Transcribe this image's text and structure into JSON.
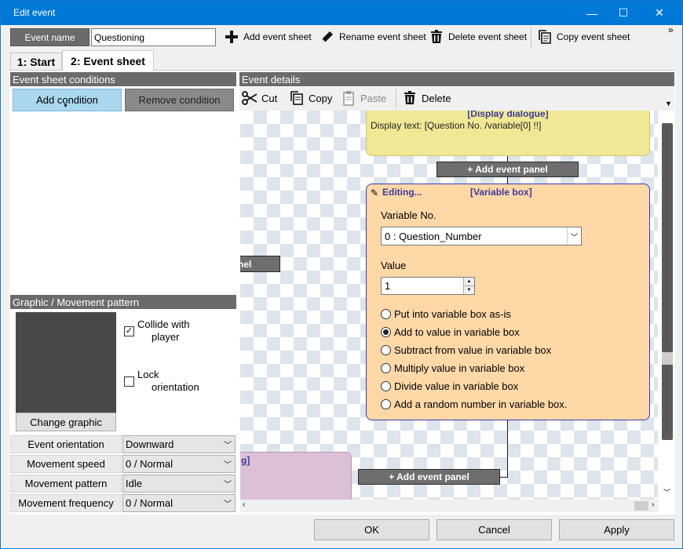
{
  "window": {
    "title": "Edit event",
    "min_glyph": "—",
    "max_glyph": "☐",
    "close_glyph": "✕"
  },
  "header": {
    "event_name_label": "Event name",
    "event_name_value": "Questioning",
    "toolbar": {
      "add_sheet": "Add event sheet",
      "rename_sheet": "Rename event sheet",
      "delete_sheet": "Delete event sheet",
      "copy_sheet": "Copy event sheet",
      "overflow": "»"
    }
  },
  "tabs": [
    {
      "label": "1: Start"
    },
    {
      "label": "2: Event sheet"
    }
  ],
  "conditions": {
    "header": "Event sheet conditions",
    "add_button": "Add condition",
    "remove_button": "Remove condition"
  },
  "graphic": {
    "header": "Graphic / Movement pattern",
    "collide_label_1": "Collide  with",
    "collide_label_2": "player",
    "collide_checked": true,
    "lock_label_1": "Lock",
    "lock_label_2": "orientation",
    "lock_checked": false,
    "change_button": "Change graphic"
  },
  "properties": [
    {
      "label": "Event orientation",
      "value": "Downward"
    },
    {
      "label": "Movement speed",
      "value": "0 / Normal"
    },
    {
      "label": "Movement pattern",
      "value": "Idle"
    },
    {
      "label": "Movement frequency",
      "value": "0 / Normal"
    }
  ],
  "details": {
    "header": "Event details",
    "cut": "Cut",
    "copy": "Copy",
    "paste": "Paste",
    "delete": "Delete"
  },
  "canvas": {
    "dialogue_panel": {
      "title": "[Display dialogue]",
      "text": "Display text: [Question No. /variable[0] !!]"
    },
    "add_panel_top": "+ Add event panel",
    "add_panel_bottom": "+ Add event panel",
    "left_fragment": "nel",
    "pink_fragment": "g]",
    "variable_panel": {
      "editing": "Editing...",
      "title": "[Variable box]",
      "var_no_label": "Variable No.",
      "var_no_value": "0 : Question_Number",
      "value_label": "Value",
      "value": "1",
      "options": [
        {
          "label": "Put into variable box as-is",
          "selected": false
        },
        {
          "label": "Add to value in variable box",
          "selected": true
        },
        {
          "label": "Subtract from value in variable box",
          "selected": false
        },
        {
          "label": "Multiply value in variable box",
          "selected": false
        },
        {
          "label": "Divide value in variable box",
          "selected": false
        },
        {
          "label": "Add a random number in variable box.",
          "selected": false
        }
      ]
    }
  },
  "footer": {
    "ok": "OK",
    "cancel": "Cancel",
    "apply": "Apply"
  },
  "colors": {
    "titlebar": "#0078d7",
    "dialogue_panel": "#f1e896",
    "variable_panel": "#ffd8a8",
    "variable_border": "#3b3bb0",
    "pink_panel": "#dcc0d8",
    "add_condition_bg": "#a9d7ee"
  }
}
